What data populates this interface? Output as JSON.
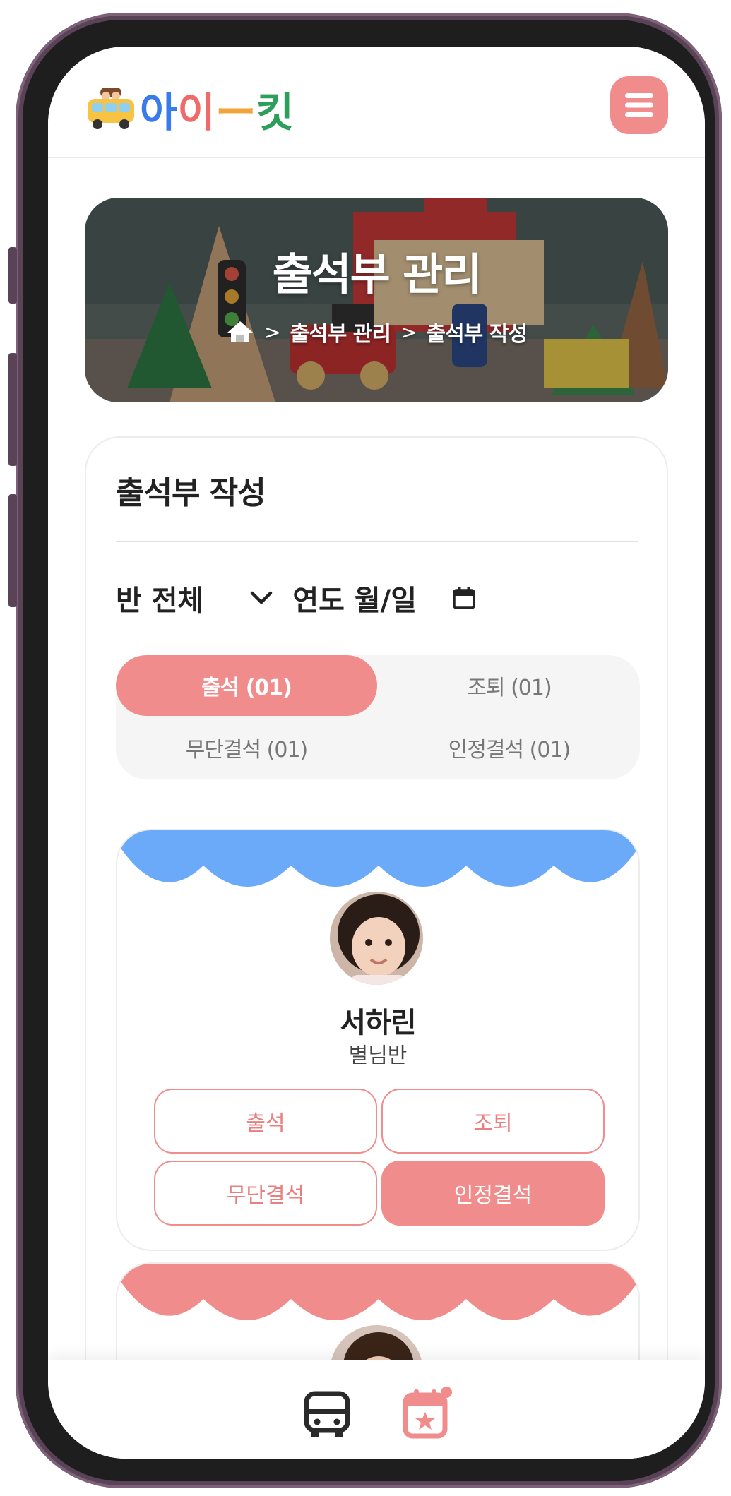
{
  "header": {
    "logo_chars": [
      "아",
      "이",
      "ー",
      "킷"
    ],
    "logo_colors": [
      "#3a7bea",
      "#f06a6a",
      "#f2a33a",
      "#2e9e5b"
    ]
  },
  "banner": {
    "title": "출석부 관리",
    "breadcrumb": [
      "출석부 관리",
      "출석부 작성"
    ],
    "separator": ">"
  },
  "card": {
    "title": "출석부 작성",
    "class_filter": "반 전체",
    "date_filter": "연도 월/일"
  },
  "status_tabs": [
    {
      "label": "출석 (01)",
      "active": true
    },
    {
      "label": "조퇴 (01)",
      "active": false
    },
    {
      "label": "무단결석 (01)",
      "active": false
    },
    {
      "label": "인정결석 (01)",
      "active": false
    }
  ],
  "students": [
    {
      "name": "서하린",
      "class": "별님반",
      "scallop_color": "#6aaaf8",
      "buttons": [
        {
          "label": "출석",
          "selected": false
        },
        {
          "label": "조퇴",
          "selected": false
        },
        {
          "label": "무단결석",
          "selected": false
        },
        {
          "label": "인정결석",
          "selected": true
        }
      ]
    },
    {
      "scallop_color": "#f08c8c"
    }
  ],
  "colors": {
    "accent": "#f08c8c",
    "text": "#222222",
    "muted": "#777777"
  }
}
